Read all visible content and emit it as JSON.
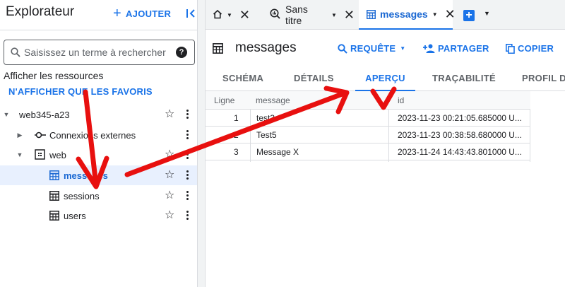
{
  "explorer": {
    "title": "Explorateur",
    "add_label": "AJOUTER",
    "search_placeholder": "Saisissez un terme à rechercher",
    "help_symbol": "?",
    "show_resources": "Afficher les ressources",
    "favorites_link": "N'AFFICHER QUE LES FAVORIS",
    "tree": [
      {
        "label": "web345-a23",
        "icon": "none",
        "expanded": true
      },
      {
        "label": "Connexions externes",
        "icon": "external-connection-icon",
        "expanded": false
      },
      {
        "label": "web",
        "icon": "dataset-icon",
        "expanded": true
      },
      {
        "label": "messages",
        "icon": "table-icon",
        "selected": true
      },
      {
        "label": "sessions",
        "icon": "table-icon"
      },
      {
        "label": "users",
        "icon": "table-icon"
      }
    ]
  },
  "tabs": [
    {
      "label": "",
      "icon": "home-icon"
    },
    {
      "label": "Sans titre",
      "icon": "query-icon"
    },
    {
      "label": "messages",
      "icon": "table-icon",
      "active": true
    }
  ],
  "table_header": {
    "name": "messages",
    "query_label": "REQUÊTE",
    "share_label": "PARTAGER",
    "copy_label": "COPIER"
  },
  "subtabs": [
    "SCHÉMA",
    "DÉTAILS",
    "APERÇU",
    "TRAÇABILITÉ",
    "PROFIL DE"
  ],
  "active_subtab": "APERÇU",
  "grid": {
    "columns": [
      "Ligne",
      "message",
      "id"
    ],
    "rows": [
      {
        "line": "1",
        "message": "test3",
        "id": "2023-11-23 00:21:05.685000 U..."
      },
      {
        "line": "2",
        "message": "Test5",
        "id": "2023-11-23 00:38:58.680000 U..."
      },
      {
        "line": "3",
        "message": "Message X",
        "id": "2023-11-24 14:43:43.801000 U..."
      }
    ]
  },
  "colors": {
    "accent": "#1a73e8",
    "annotation": "#e8100f",
    "selected_bg": "#e8f0fe"
  }
}
